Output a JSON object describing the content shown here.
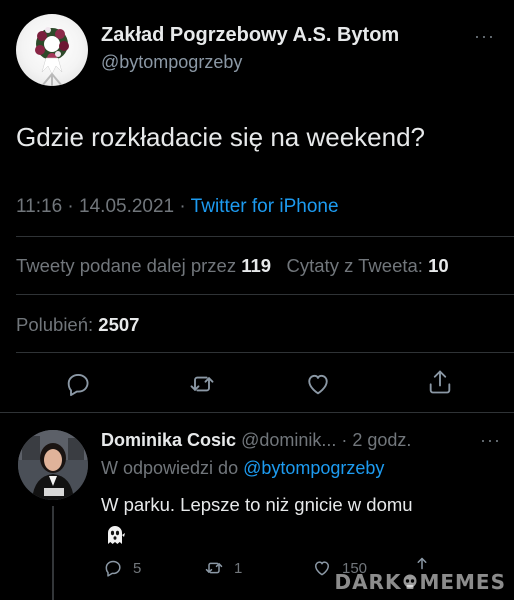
{
  "tweet": {
    "author_name": "Zakład Pogrzebowy A.S. Bytom",
    "author_handle": "@bytompogrzeby",
    "more_label": "···",
    "text": "Gdzie rozkładacie się na weekend?",
    "time": "11:16",
    "date": "14.05.2021",
    "separator": "·",
    "source": "Twitter for iPhone"
  },
  "stats": {
    "retweets_label": "Tweety podane dalej przez",
    "retweets_count": "119",
    "quotes_label": "Cytaty z Tweeta:",
    "quotes_count": "10",
    "likes_label": "Polubień:",
    "likes_count": "2507"
  },
  "icons": {
    "reply": "reply-icon",
    "retweet": "retweet-icon",
    "like": "heart-icon",
    "share": "share-icon"
  },
  "reply": {
    "author_name": "Dominika Cosic",
    "author_handle": "@dominik...",
    "time_ago": "· 2 godz.",
    "more_label": "···",
    "in_reply_to_label": "W odpowiedzi do",
    "in_reply_to_handle": "@bytompogrzeby",
    "text": "W parku. Lepsze to niż gnicie w domu",
    "emoji": "ghost",
    "reply_count": "5",
    "retweet_count": "1",
    "like_count": "150"
  },
  "watermark": {
    "left": "DARK",
    "right": "MEMES"
  },
  "colors": {
    "background": "#000000",
    "text": "#e7e9ea",
    "muted": "#71767b",
    "link": "#1d9bf0",
    "divider": "#2f3336"
  }
}
